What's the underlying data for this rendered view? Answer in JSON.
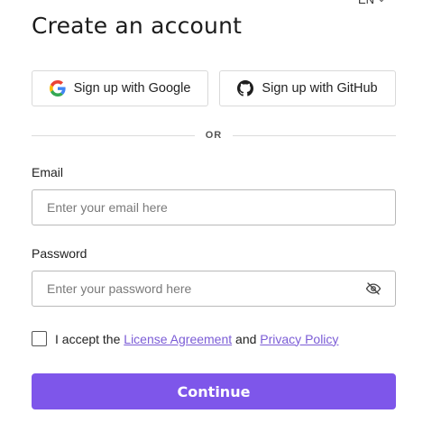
{
  "header": {
    "language": "EN",
    "title": "Create an account"
  },
  "social": {
    "google_label": "Sign up with Google",
    "github_label": "Sign up with GitHub"
  },
  "divider": {
    "text": "OR"
  },
  "form": {
    "email_label": "Email",
    "email_placeholder": "Enter your email here",
    "email_value": "",
    "password_label": "Password",
    "password_placeholder": "Enter your password here",
    "password_value": ""
  },
  "terms": {
    "prefix": "I accept the",
    "license_link": "License Agreement",
    "connector": "and",
    "privacy_link": "Privacy Policy",
    "checked": false
  },
  "actions": {
    "continue_label": "Continue"
  },
  "colors": {
    "accent": "#7e56ea",
    "link": "#7b5cd6",
    "border": "#b9b9b9"
  },
  "icons": {
    "google": "google-logo-icon",
    "github": "github-logo-icon",
    "password_toggle": "eye-slash-icon",
    "language_dropdown": "chevron-down-icon"
  }
}
